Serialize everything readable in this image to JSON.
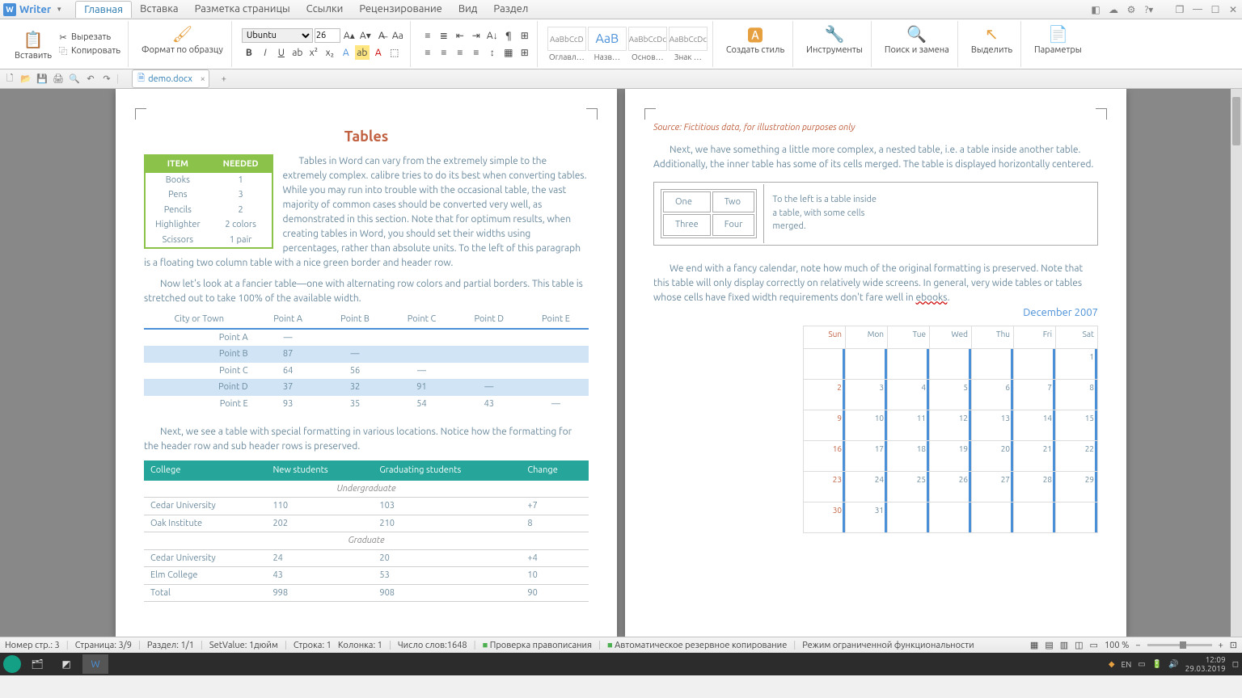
{
  "app": {
    "name": "Writer"
  },
  "tabs": {
    "home": "Главная",
    "insert": "Вставка",
    "layout": "Разметка страницы",
    "links": "Ссылки",
    "review": "Рецензирование",
    "view": "Вид",
    "section": "Раздел"
  },
  "clipboard": {
    "paste": "Вставить",
    "cut": "Вырезать",
    "copy": "Копировать",
    "fmt": "Формат по образцу"
  },
  "font": {
    "name": "Ubuntu",
    "size": "26"
  },
  "styles": {
    "s1": "AaBbCcD",
    "s2": "AaB",
    "s3": "AaBbCcDc",
    "s4": "AaBbCcDc",
    "lbl1": "Оглавл…",
    "lbl2": "Назв…",
    "lbl3": "Основ…",
    "lbl4": "Знак …"
  },
  "actions": {
    "newstyle": "Создать стиль",
    "tools": "Инструменты",
    "find": "Поиск и замена",
    "select": "Выделить",
    "params": "Параметры"
  },
  "doc_tab": "demo.docx",
  "doc": {
    "title": "Tables",
    "para1": "Tables in Word can vary from the extremely simple to the extremely complex. calibre tries to do its best when converting tables. While you may run into trouble with the occasional table, the vast majority of common cases should be converted very well, as demonstrated in this section. Note that for optimum results, when creating tables in Word, you should set their widths using percentages, rather than absolute units.  To the left of this paragraph is a floating two column table with a nice green border and header row.",
    "para2": "Now let's look at a fancier table—one with alternating row colors and partial borders. This table is stretched out to take 100% of the available width.",
    "para3": "Next, we see a table with special formatting in various locations. Notice how the formatting for the header row and sub header rows is preserved.",
    "items": {
      "h1": "ITEM",
      "h2": "NEEDED",
      "rows": [
        [
          "Books",
          "1"
        ],
        [
          "Pens",
          "3"
        ],
        [
          "Pencils",
          "2"
        ],
        [
          "Highlighter",
          "2 colors"
        ],
        [
          "Scissors",
          "1 pair"
        ]
      ]
    },
    "points": {
      "hdr": [
        "City or Town",
        "Point A",
        "Point B",
        "Point C",
        "Point D",
        "Point E"
      ],
      "rows": [
        [
          "Point A",
          "—",
          "",
          "",
          "",
          ""
        ],
        [
          "Point B",
          "87",
          "—",
          "",
          "",
          ""
        ],
        [
          "Point C",
          "64",
          "56",
          "—",
          "",
          ""
        ],
        [
          "Point D",
          "37",
          "32",
          "91",
          "—",
          ""
        ],
        [
          "Point E",
          "93",
          "35",
          "54",
          "43",
          "—"
        ]
      ]
    },
    "college": {
      "hdr": [
        "College",
        "New students",
        "Graduating students",
        "Change"
      ],
      "sub1": "Undergraduate",
      "sub2": "Graduate",
      "rows1": [
        [
          "Cedar University",
          "110",
          "103",
          "+7"
        ],
        [
          "Oak Institute",
          "202",
          "210",
          "8"
        ]
      ],
      "rows2": [
        [
          "Cedar University",
          "24",
          "20",
          "+4"
        ],
        [
          "Elm College",
          "43",
          "53",
          "10"
        ]
      ],
      "total": [
        "Total",
        "998",
        "908",
        "90"
      ]
    }
  },
  "doc2": {
    "src": "Source: Fictitious data, for illustration purposes only",
    "para1": "Next, we have something a little more complex, a nested table, i.e. a table inside another table. Additionally, the inner table has some of its cells merged. The table is displayed horizontally centered.",
    "nested": {
      "c1": "One",
      "c2": "Two",
      "c3": "Three",
      "c4": "Four",
      "side": "To the left is a table inside a table, with some cells merged."
    },
    "para2_a": "We end with a fancy calendar, note how much of the original formatting is preserved. Note that this table will only display correctly on relatively wide screens. In general, very wide tables or tables whose cells have fixed width requirements don't fare well in ",
    "para2_b": "ebooks",
    "para2_c": ".",
    "cal_title": "December 2007",
    "days": [
      "Sun",
      "Mon",
      "Tue",
      "Wed",
      "Thu",
      "Fri",
      "Sat"
    ]
  },
  "status": {
    "page": "Номер стр.: 3",
    "pages": "Страница: 3/9",
    "section": "Раздел: 1/1",
    "setval": "SetValue: 1дюйм",
    "line": "Строка: 1",
    "col": "Колонка: 1",
    "words": "Число слов:1648",
    "spell": "Проверка правописания",
    "backup": "Автоматическое резервное копирование",
    "mode": "Режим ограниченной функциональности",
    "zoom": "100 %"
  },
  "taskbar": {
    "lang": "EN",
    "time": "12:09",
    "date": "29.03.2019"
  }
}
